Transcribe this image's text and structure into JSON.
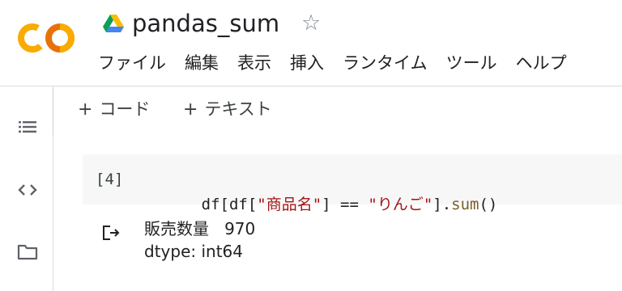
{
  "header": {
    "notebook_title": "pandas_sum",
    "menu": [
      {
        "label": "ファイル"
      },
      {
        "label": "編集"
      },
      {
        "label": "表示"
      },
      {
        "label": "挿入"
      },
      {
        "label": "ランタイム"
      },
      {
        "label": "ツール"
      },
      {
        "label": "ヘルプ"
      }
    ]
  },
  "toolbar": {
    "add_code_label": "コード",
    "add_text_label": "テキスト",
    "plus_glyph": "+"
  },
  "cell": {
    "execution_count": "[4]",
    "code_tokens": [
      {
        "text": "df[df[",
        "kind": "plain"
      },
      {
        "text": "\"商品名\"",
        "kind": "str"
      },
      {
        "text": "] == ",
        "kind": "plain"
      },
      {
        "text": "\"りんご\"",
        "kind": "str"
      },
      {
        "text": "].",
        "kind": "plain"
      },
      {
        "text": "sum",
        "kind": "fn"
      },
      {
        "text": "()",
        "kind": "plain"
      }
    ],
    "output_lines": [
      "販売数量   970",
      "dtype: int64"
    ]
  },
  "icons": {
    "logo": "colab-logo",
    "drive": "google-drive-icon",
    "star": "star-outline-icon",
    "toc": "table-of-contents-icon",
    "code_snippets": "code-brackets-icon",
    "files": "folder-icon",
    "output": "output-arrow-icon"
  },
  "colors": {
    "logo_orange": "#F9AB00",
    "logo_deep_orange": "#E8710A",
    "string": "#a31515",
    "function": "#795e26",
    "cell_background": "#f7f7f7"
  }
}
